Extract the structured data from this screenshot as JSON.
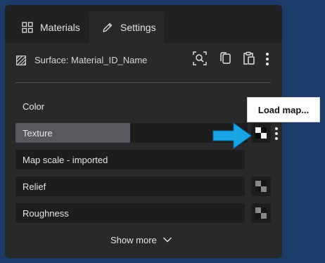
{
  "tabs": [
    {
      "label": "Materials",
      "icon": "grid-icon",
      "active": false
    },
    {
      "label": "Settings",
      "icon": "pencil-icon",
      "active": true
    }
  ],
  "header": {
    "title": "Surface: Material_ID_Name",
    "icons": [
      "surface-swatch-icon",
      "zoom-select-icon",
      "copy-icon",
      "paste-icon",
      "more-vertical-icon"
    ]
  },
  "properties": {
    "color_label": "Color",
    "texture": {
      "label": "Texture",
      "fill_fraction": 0.5
    },
    "map_scale": {
      "label": "Map scale - imported"
    },
    "relief": {
      "label": "Relief"
    },
    "roughness": {
      "label": "Roughness"
    }
  },
  "tooltip": {
    "text": "Load map..."
  },
  "show_more": {
    "label": "Show more"
  },
  "colors": {
    "background": "#1d3d68",
    "panel": "#28292b",
    "tab_bar": "#1f2022",
    "field": "#1c1d1f",
    "texture_fill": "#58595c",
    "color_swatch": "#1f57a8",
    "annotation_arrow": "#1aa5e6"
  }
}
